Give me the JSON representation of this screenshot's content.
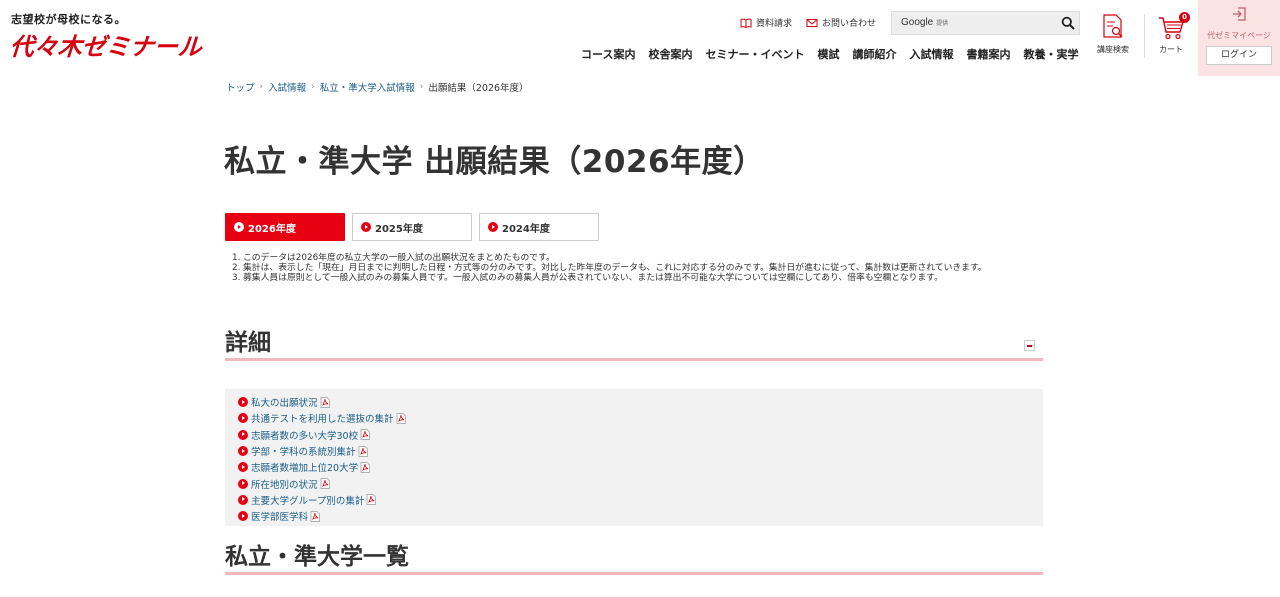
{
  "header": {
    "tagline": "志望校が母校になる。",
    "logo": "代々木ゼミナール",
    "util_links": [
      {
        "label": "資料請求",
        "icon": "book-icon"
      },
      {
        "label": "お問い合わせ",
        "icon": "mail-icon"
      }
    ],
    "search": {
      "brand": "Google",
      "brand_sub": "提供",
      "placeholder": ""
    },
    "nav": [
      "コース案内",
      "校舎案内",
      "セミナー・イベント",
      "模試",
      "講師紹介",
      "入試情報",
      "書籍案内",
      "教養・実学"
    ],
    "course_search_label": "講座検索",
    "cart_label": "カート",
    "cart_count": "0",
    "mypage_label": "代ゼミマイページ",
    "login_label": "ログイン"
  },
  "breadcrumb": [
    "トップ",
    "入試情報",
    "私立・準大学入試情報",
    "出願結果（2026年度）"
  ],
  "page_title": "私立・準大学 出願結果（2026年度）",
  "year_tabs": [
    {
      "label": "2026年度",
      "active": true
    },
    {
      "label": "2025年度",
      "active": false
    },
    {
      "label": "2024年度",
      "active": false
    }
  ],
  "notes": [
    {
      "num": "1.",
      "text": "このデータは2026年度の私立大学の一般入試の出願状況をまとめたものです。"
    },
    {
      "num": "2.",
      "text": "集計は、表示した「現在」月日までに判明した日程・方式等の分のみです。対比した昨年度のデータも、これに対応する分のみです。集計日が進むに従って、集計数は更新されていきます。"
    },
    {
      "num": "3.",
      "text": "募集人員は原則として一般入試のみの募集人員です。一般入試のみの募集人員が公表されていない、または算出不可能な大学については空欄にしてあり、倍率も空欄となります。"
    }
  ],
  "detail": {
    "heading": "詳細",
    "links": [
      "私大の出願状況",
      "共通テストを利用した選抜の集計",
      "志願者数の多い大学30校",
      "学部・学科の系統別集計",
      "志願者数増加上位20大学",
      "所在地別の状況",
      "主要大学グループ別の集計",
      "医学部医学科"
    ]
  },
  "list_section": {
    "heading": "私立・準大学一覧"
  },
  "colors": {
    "brand_red": "#d7000f",
    "tab_active": "#e60012",
    "link": "#1a5e8a",
    "heading_rule": "#f0b9bc",
    "mypage_bg": "#fbe3e4"
  }
}
